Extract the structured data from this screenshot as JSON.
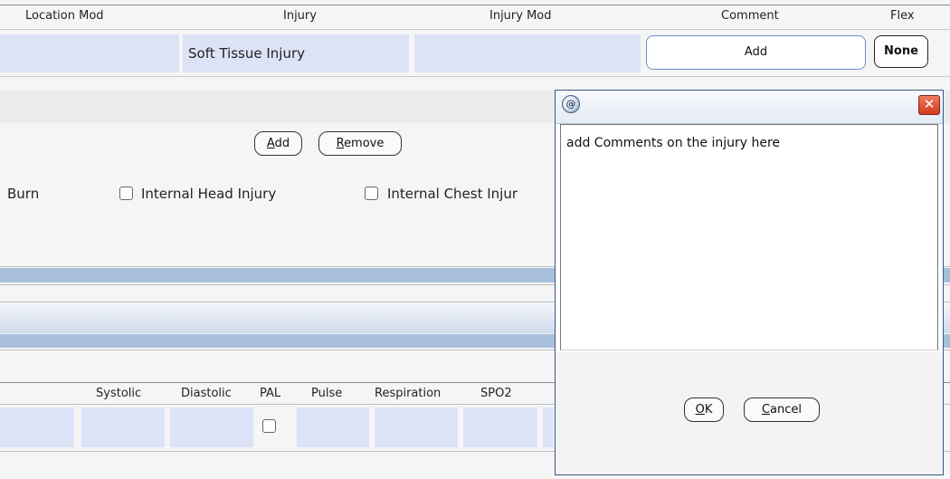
{
  "injury_table": {
    "headers": {
      "location_mod": "Location Mod",
      "injury": "Injury",
      "injury_mod": "Injury Mod",
      "comment": "Comment",
      "flex": "Flex"
    },
    "row": {
      "injury": "Soft Tissue Injury",
      "comment_button": "Add",
      "flex_button": "None"
    }
  },
  "actions": {
    "add": "Add",
    "remove": "Remove"
  },
  "checkboxes": [
    "Burn",
    "Internal Head Injury",
    "Internal Chest Injur"
  ],
  "vitals": {
    "headers": [
      "Systolic",
      "Diastolic",
      "PAL",
      "Pulse",
      "Respiration",
      "SPO2"
    ]
  },
  "dialog": {
    "comment_text": "add Comments on the injury here",
    "close_glyph": "✕",
    "logo_glyph": "@",
    "ok_label": "OK",
    "cancel_label": "Cancel"
  },
  "colors": {
    "cell_fill": "#dde3f7",
    "band_blue": "#a8bfdc",
    "close_red": "#d23a1c"
  }
}
